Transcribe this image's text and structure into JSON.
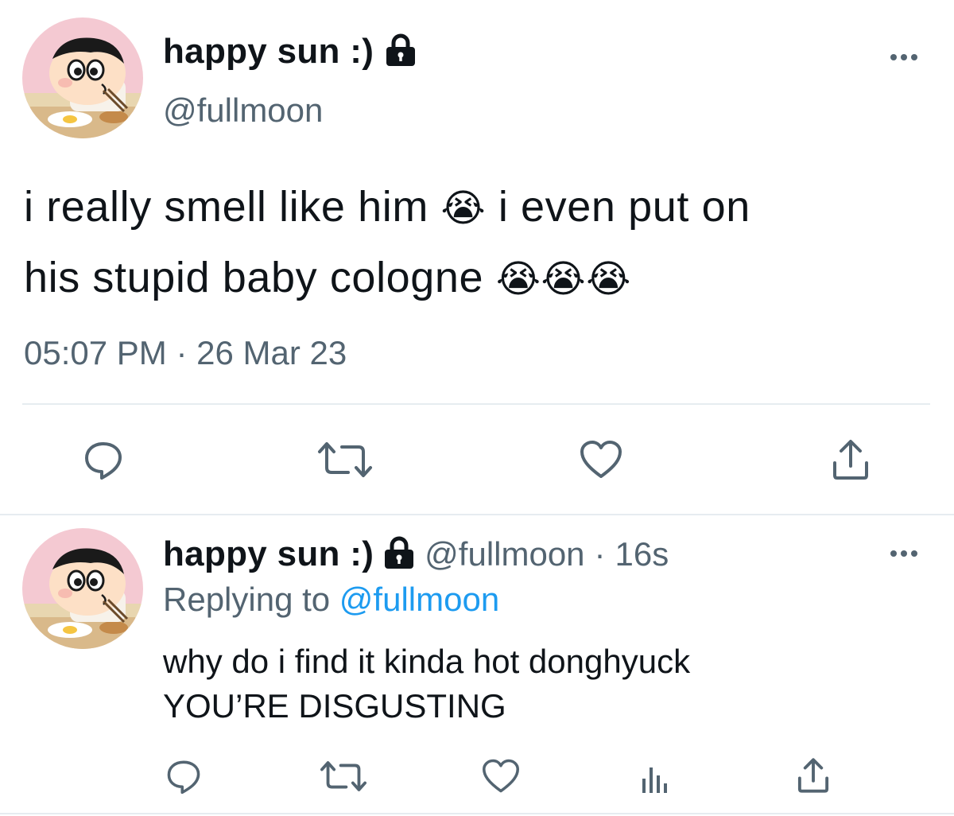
{
  "main_tweet": {
    "display_name": "happy sun :)",
    "handle": "@fullmoon",
    "text_line1": "i really smell like him",
    "text_line1b": "i even put on",
    "text_line2": "his stupid baby cologne",
    "emoji": "😭",
    "time": "05:07 PM",
    "separator": "·",
    "date": "26 Mar 23",
    "actions": [
      "reply",
      "retweet",
      "like",
      "share"
    ]
  },
  "reply_tweet": {
    "display_name": "happy sun :)",
    "handle": "@fullmoon",
    "separator": "·",
    "age": "16s",
    "replying_to_label": "Replying to",
    "replying_to_handle": "@fullmoon",
    "text_line1": "why do i find it kinda hot donghyuck",
    "text_line2": "YOU’RE DISGUSTING",
    "actions": [
      "reply",
      "retweet",
      "like",
      "analytics",
      "share"
    ]
  },
  "colors": {
    "text": "#0f1419",
    "secondary": "#536471",
    "link": "#1d9bf0",
    "divider": "#e6ecf0"
  },
  "icons": {
    "lock": "lock-icon",
    "more": "more-icon",
    "reply": "reply-icon",
    "retweet": "retweet-icon",
    "like": "heart-icon",
    "share": "share-icon",
    "analytics": "analytics-icon"
  }
}
